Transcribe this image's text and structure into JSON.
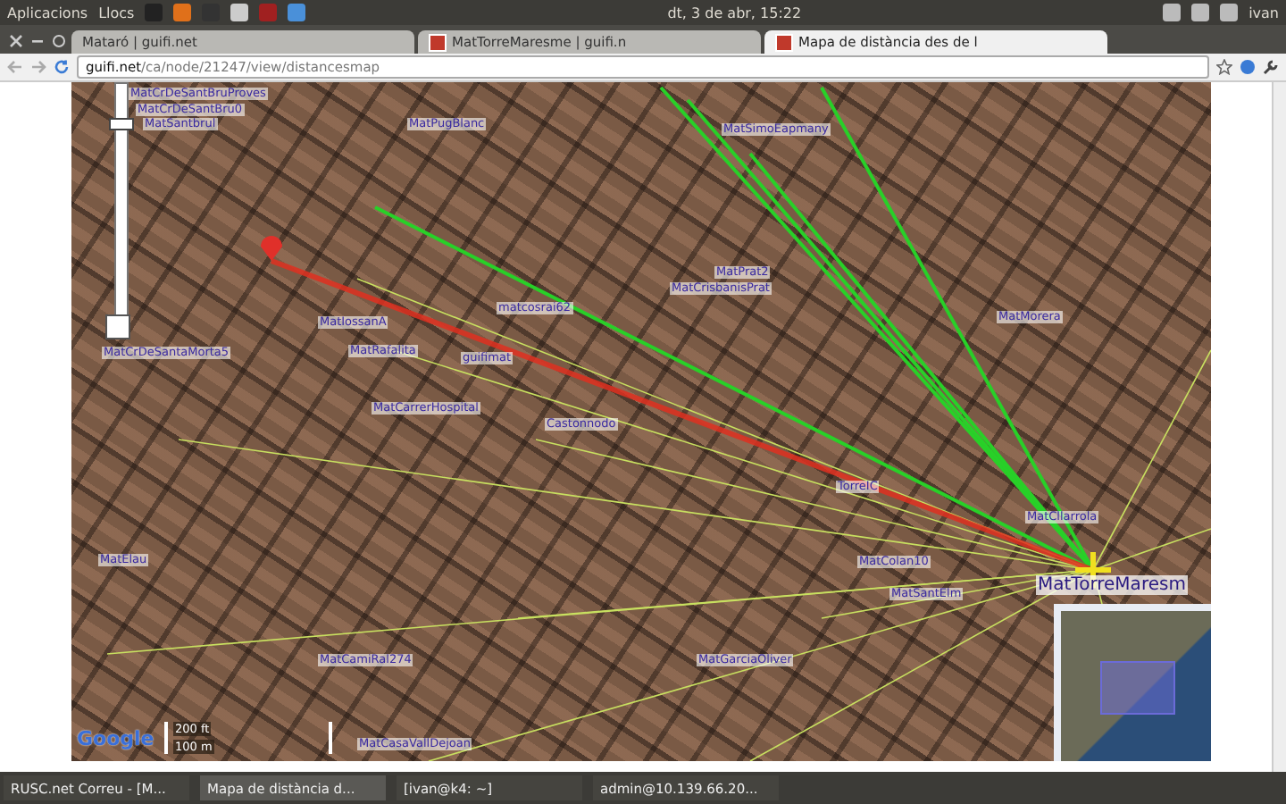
{
  "top_panel": {
    "menus": [
      "Aplicacions",
      "Llocs"
    ],
    "clock": "dt, 3 de abr, 15:22",
    "user": "ivan"
  },
  "tabs": [
    {
      "label": "Mataró | guifi.net",
      "selected": false,
      "favicon": false
    },
    {
      "label": "MatTorreMaresme | guifi.n",
      "selected": false,
      "favicon": true
    },
    {
      "label": "Mapa de distància des de l",
      "selected": true,
      "favicon": true
    }
  ],
  "address_bar": {
    "url_host": "guifi.net",
    "url_path": "/ca/node/21247/view/distancesmap"
  },
  "map": {
    "labels": [
      {
        "text": "MatCrDeSantBruProves",
        "kind": "node"
      },
      {
        "text": "MatCrDeSantBru0",
        "kind": "node"
      },
      {
        "text": "MatSantbrul",
        "kind": "node"
      },
      {
        "text": "MatPugBlanc",
        "kind": "node"
      },
      {
        "text": "MatSimoEapmany",
        "kind": "node"
      },
      {
        "text": "MatPrat2",
        "kind": "node"
      },
      {
        "text": "MatCrisbanisPrat",
        "kind": "node"
      },
      {
        "text": "matcosrai62",
        "kind": "node"
      },
      {
        "text": "MatMorera",
        "kind": "node"
      },
      {
        "text": "MatIossanA",
        "kind": "node"
      },
      {
        "text": "MatCrDeSantaMorta5",
        "kind": "node"
      },
      {
        "text": "MatRafalita",
        "kind": "node"
      },
      {
        "text": "guifimat",
        "kind": "node"
      },
      {
        "text": "MatCarrerHospital",
        "kind": "node"
      },
      {
        "text": "Castonnodo",
        "kind": "node"
      },
      {
        "text": "TorreIC",
        "kind": "node"
      },
      {
        "text": "MatCllarrola",
        "kind": "node"
      },
      {
        "text": "MatElau",
        "kind": "node"
      },
      {
        "text": "MatColan10",
        "kind": "node"
      },
      {
        "text": "MatSantElm",
        "kind": "node"
      },
      {
        "text": "MatTorreMaresm",
        "kind": "origin"
      },
      {
        "text": "MatCamiRal274",
        "kind": "node"
      },
      {
        "text": "MatGarciaOliver",
        "kind": "node"
      },
      {
        "text": "MatCasaVallDejoan",
        "kind": "node"
      }
    ],
    "zoom": {
      "level": 0.85
    },
    "scale": [
      "200 ft",
      "100 m"
    ],
    "logo": "Google"
  },
  "taskbar": [
    {
      "label": "RUSC.net Correu - [M...",
      "selected": false
    },
    {
      "label": "Mapa de distància d...",
      "selected": true
    },
    {
      "label": "[ivan@k4: ~]",
      "selected": false
    },
    {
      "label": "admin@10.139.66.20...",
      "selected": false
    }
  ]
}
